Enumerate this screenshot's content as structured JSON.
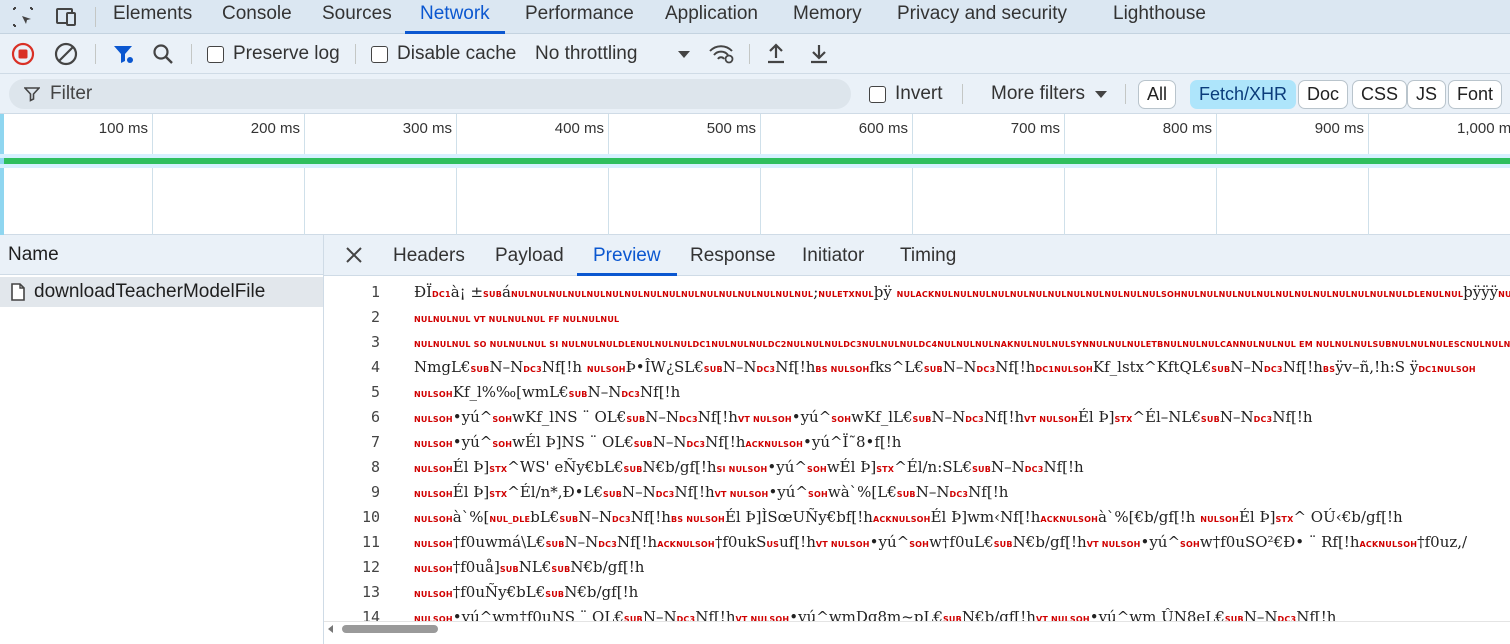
{
  "main_tabs": [
    {
      "label": "Elements"
    },
    {
      "label": "Console"
    },
    {
      "label": "Sources"
    },
    {
      "label": "Network",
      "active": true
    },
    {
      "label": "Performance"
    },
    {
      "label": "Application"
    },
    {
      "label": "Memory"
    },
    {
      "label": "Privacy and security"
    },
    {
      "label": "Lighthouse"
    }
  ],
  "toolbar": {
    "preserve_log": "Preserve log",
    "disable_cache": "Disable cache",
    "throttling": "No throttling"
  },
  "filter": {
    "placeholder": "Filter",
    "invert": "Invert",
    "more_filters": "More filters",
    "types": [
      "All",
      "Fetch/XHR",
      "Doc",
      "CSS",
      "JS",
      "Font"
    ],
    "selected_type": "Fetch/XHR"
  },
  "timeline": {
    "ticks": [
      "100 ms",
      "200 ms",
      "300 ms",
      "400 ms",
      "500 ms",
      "600 ms",
      "700 ms",
      "800 ms",
      "900 ms",
      "1,000 m"
    ]
  },
  "requests": {
    "header": "Name",
    "items": [
      {
        "name": "downloadTeacherModelFile"
      }
    ]
  },
  "detail_tabs": [
    {
      "label": "Headers"
    },
    {
      "label": "Payload"
    },
    {
      "label": "Preview",
      "active": true
    },
    {
      "label": "Response"
    },
    {
      "label": "Initiator"
    },
    {
      "label": "Timing"
    }
  ],
  "preview_lines": [
    {
      "n": "1",
      "segs": [
        [
          "t",
          "ÐÏ"
        ],
        [
          "c",
          "DC1"
        ],
        [
          "t",
          "à¡ ±"
        ],
        [
          "c",
          "SUB"
        ],
        [
          "t",
          "á"
        ],
        [
          "c",
          "NULNULNULNULNULNULNULNULNULNULNULNULNULNULNULNUL"
        ],
        [
          "t",
          ";"
        ],
        [
          "c",
          "NULETXNUL"
        ],
        [
          "t",
          "þÿ      "
        ],
        [
          "c",
          "NULACKNULNULNULNULNULNULNULNULNULNULNULNULSOHNULNULNULNULNULNULNULNULNULNULNULNULDLENULNUL"
        ],
        [
          "t",
          "þÿÿÿ"
        ],
        [
          "c",
          "NULNUL"
        ]
      ]
    },
    {
      "n": "2",
      "segs": [
        [
          "c",
          "NULNULNUL VT NULNULNUL FF NULNULNUL"
        ]
      ]
    },
    {
      "n": "3",
      "segs": [
        [
          "c",
          "NULNULNUL SO NULNULNUL SI NULNULNULDLENULNULNULDC1NULNULNULDC2NULNULNULDC3NULNULNULDC4NULNULNULNAKNULNULNULSYNNULNULNULETBNULNULNULCANNULNULNUL EM NULNULNULSUBNULNULNULESCNULNULNUL FS NUL"
        ]
      ]
    },
    {
      "n": "4",
      "segs": [
        [
          "t",
          "NmgL€"
        ],
        [
          "c",
          "SUB"
        ],
        [
          "t",
          "N–N"
        ],
        [
          "c",
          "DC3"
        ],
        [
          "t",
          "Nf[!h  "
        ],
        [
          "c",
          "NULSOH"
        ],
        [
          "t",
          "Þ•ÎW¿SL€"
        ],
        [
          "c",
          "SUB"
        ],
        [
          "t",
          "N–N"
        ],
        [
          "c",
          "DC3"
        ],
        [
          "t",
          "Nf[!h"
        ],
        [
          "c",
          "BS NULSOH"
        ],
        [
          "t",
          "fks^L€"
        ],
        [
          "c",
          "SUB"
        ],
        [
          "t",
          "N–N"
        ],
        [
          "c",
          "DC3"
        ],
        [
          "t",
          "Nf[!h"
        ],
        [
          "c",
          "DC1NULSOH"
        ],
        [
          "t",
          "Kf_lstx^KftQL€"
        ],
        [
          "c",
          "SUB"
        ],
        [
          "t",
          "N–N"
        ],
        [
          "c",
          "DC3"
        ],
        [
          "t",
          "Nf[!h"
        ],
        [
          "c",
          "BS"
        ],
        [
          "t",
          "ÿv–ñ,!h:S  ÿ"
        ],
        [
          "c",
          "DC1NULSOH"
        ]
      ]
    },
    {
      "n": "5",
      "segs": [
        [
          "c",
          "NULSOH"
        ],
        [
          "t",
          "Kf_l%‰[wmL€"
        ],
        [
          "c",
          "SUB"
        ],
        [
          "t",
          "N–N"
        ],
        [
          "c",
          "DC3"
        ],
        [
          "t",
          "Nf[!h"
        ]
      ]
    },
    {
      "n": "6",
      "segs": [
        [
          "c",
          "NULSOH"
        ],
        [
          "t",
          "•yú^"
        ],
        [
          "c",
          "SOH"
        ],
        [
          "t",
          "wKf_lNS ¨ OL€"
        ],
        [
          "c",
          "SUB"
        ],
        [
          "t",
          "N–N"
        ],
        [
          "c",
          "DC3"
        ],
        [
          "t",
          "Nf[!h"
        ],
        [
          "c",
          "VT NULSOH"
        ],
        [
          "t",
          "•yú^"
        ],
        [
          "c",
          "SOH"
        ],
        [
          "t",
          "wKf_lL€"
        ],
        [
          "c",
          "SUB"
        ],
        [
          "t",
          "N–N"
        ],
        [
          "c",
          "DC3"
        ],
        [
          "t",
          "Nf[!h"
        ],
        [
          "c",
          "VT NULSOH"
        ],
        [
          "t",
          "Él Þ]"
        ],
        [
          "c",
          "STX"
        ],
        [
          "t",
          "^Él–NL€"
        ],
        [
          "c",
          "SUB"
        ],
        [
          "t",
          "N–N"
        ],
        [
          "c",
          "DC3"
        ],
        [
          "t",
          "Nf[!h"
        ]
      ]
    },
    {
      "n": "7",
      "segs": [
        [
          "c",
          "NULSOH"
        ],
        [
          "t",
          "•yú^"
        ],
        [
          "c",
          "SOH"
        ],
        [
          "t",
          "wÉl Þ]NS ¨ OL€"
        ],
        [
          "c",
          "SUB"
        ],
        [
          "t",
          "N–N"
        ],
        [
          "c",
          "DC3"
        ],
        [
          "t",
          "Nf[!h"
        ],
        [
          "c",
          "ACKNULSOH"
        ],
        [
          "t",
          "•yú^Ï˜8•f[!h"
        ]
      ]
    },
    {
      "n": "8",
      "segs": [
        [
          "c",
          "NULSOH"
        ],
        [
          "t",
          "Él Þ]"
        ],
        [
          "c",
          "STX"
        ],
        [
          "t",
          "^WS' eÑy€bL€"
        ],
        [
          "c",
          "SUB"
        ],
        [
          "t",
          "N€b/gf[!h"
        ],
        [
          "c",
          "SI NULSOH"
        ],
        [
          "t",
          "•yú^"
        ],
        [
          "c",
          "SOH"
        ],
        [
          "t",
          "wÉl Þ]"
        ],
        [
          "c",
          "STX"
        ],
        [
          "t",
          "^Él/n:SL€"
        ],
        [
          "c",
          "SUB"
        ],
        [
          "t",
          "N–N"
        ],
        [
          "c",
          "DC3"
        ],
        [
          "t",
          "Nf[!h"
        ]
      ]
    },
    {
      "n": "9",
      "segs": [
        [
          "c",
          "NULSOH"
        ],
        [
          "t",
          "Él Þ]"
        ],
        [
          "c",
          "STX"
        ],
        [
          "t",
          "^Él/n*,Ð•L€"
        ],
        [
          "c",
          "SUB"
        ],
        [
          "t",
          "N–N"
        ],
        [
          "c",
          "DC3"
        ],
        [
          "t",
          "Nf[!h"
        ],
        [
          "c",
          "VT NULSOH"
        ],
        [
          "t",
          "•yú^"
        ],
        [
          "c",
          "SOH"
        ],
        [
          "t",
          "wà`%[L€"
        ],
        [
          "c",
          "SUB"
        ],
        [
          "t",
          "N–N"
        ],
        [
          "c",
          "DC3"
        ],
        [
          "t",
          "Nf[!h"
        ]
      ]
    },
    {
      "n": "10",
      "segs": [
        [
          "c",
          "NULSOH"
        ],
        [
          "t",
          "à`%["
        ],
        [
          "c",
          "NUL_DLE"
        ],
        [
          "t",
          "bL€"
        ],
        [
          "c",
          "SUB"
        ],
        [
          "t",
          "N–N"
        ],
        [
          "c",
          "DC3"
        ],
        [
          "t",
          "Nf[!h"
        ],
        [
          "c",
          "BS NULSOH"
        ],
        [
          "t",
          "Él Þ]ÌSœUÑy€bf[!h"
        ],
        [
          "c",
          "ACKNULSOH"
        ],
        [
          "t",
          "Él Þ]wm‹Nf[!h"
        ],
        [
          "c",
          "ACKNULSOH"
        ],
        [
          "t",
          "à`%[€b/gf[!h "
        ],
        [
          "c",
          "NULSOH"
        ],
        [
          "t",
          "Él Þ]"
        ],
        [
          "c",
          "STX"
        ],
        [
          "t",
          "^ OÚ‹€b/gf[!h"
        ]
      ]
    },
    {
      "n": "11",
      "segs": [
        [
          "c",
          "NULSOH"
        ],
        [
          "t",
          "†f0uwmá\\L€"
        ],
        [
          "c",
          "SUB"
        ],
        [
          "t",
          "N–N"
        ],
        [
          "c",
          "DC3"
        ],
        [
          "t",
          "Nf[!h"
        ],
        [
          "c",
          "ACKNULSOH"
        ],
        [
          "t",
          "†f0ukS"
        ],
        [
          "c",
          "US"
        ],
        [
          "t",
          "uf[!h"
        ],
        [
          "c",
          "VT NULSOH"
        ],
        [
          "t",
          "•yú^"
        ],
        [
          "c",
          "SOH"
        ],
        [
          "t",
          "w†f0uL€"
        ],
        [
          "c",
          "SUB"
        ],
        [
          "t",
          "N€b/gf[!h"
        ],
        [
          "c",
          "VT NULSOH"
        ],
        [
          "t",
          "•yú^"
        ],
        [
          "c",
          "SOH"
        ],
        [
          "t",
          "w†f0uSO²€Ð• ¨ Rf[!h"
        ],
        [
          "c",
          "ACKNULSOH"
        ],
        [
          "t",
          "†f0uz,/"
        ]
      ]
    },
    {
      "n": "12",
      "segs": [
        [
          "c",
          "NULSOH"
        ],
        [
          "t",
          "†f0uå]"
        ],
        [
          "c",
          "SUB"
        ],
        [
          "t",
          "NL€"
        ],
        [
          "c",
          "SUB"
        ],
        [
          "t",
          "N€b/gf[!h"
        ]
      ]
    },
    {
      "n": "13",
      "segs": [
        [
          "c",
          "NULSOH"
        ],
        [
          "t",
          "†f0uÑy€bL€"
        ],
        [
          "c",
          "SUB"
        ],
        [
          "t",
          "N€b/gf[!h"
        ]
      ]
    },
    {
      "n": "14",
      "segs": [
        [
          "c",
          "NULSOH"
        ],
        [
          "t",
          "•yú^wm†f0uNS ¨ OL€"
        ],
        [
          "c",
          "SUB"
        ],
        [
          "t",
          "N–N"
        ],
        [
          "c",
          "DC3"
        ],
        [
          "t",
          "Nf[!h"
        ],
        [
          "c",
          "VT NULSOH"
        ],
        [
          "t",
          "•yú^wmDg8m~pL€"
        ],
        [
          "c",
          "SUB"
        ],
        [
          "t",
          "N€b/gf[!h"
        ],
        [
          "c",
          "VT NULSOH"
        ],
        [
          "t",
          "•yú^wm ÛN8eL€"
        ],
        [
          "c",
          "SUB"
        ],
        [
          "t",
          "N–N"
        ],
        [
          "c",
          "DC3"
        ],
        [
          "t",
          "Nf[!h"
        ]
      ]
    }
  ]
}
